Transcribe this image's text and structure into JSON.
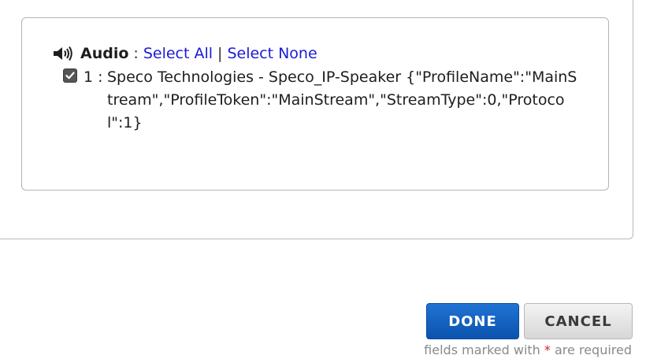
{
  "audio": {
    "title": "Audio",
    "separator": ":",
    "select_all": "Select All",
    "pipe": "|",
    "select_none": "Select None",
    "icon": "speaker-icon"
  },
  "items": [
    {
      "checked": true,
      "index": "1 :",
      "text": "Speco Technologies - Speco_IP-Speaker {\"ProfileName\":\"MainStream\",\"ProfileToken\":\"MainStream\",\"StreamType\":0,\"Protocol\":1}"
    }
  ],
  "buttons": {
    "done": "DONE",
    "cancel": "CANCEL"
  },
  "footer": {
    "prefix": "fields marked with",
    "star": "*",
    "suffix": "are required"
  },
  "colors": {
    "link": "#1a1ad6",
    "primary_button": "#0b53ad",
    "required": "#d22222"
  }
}
